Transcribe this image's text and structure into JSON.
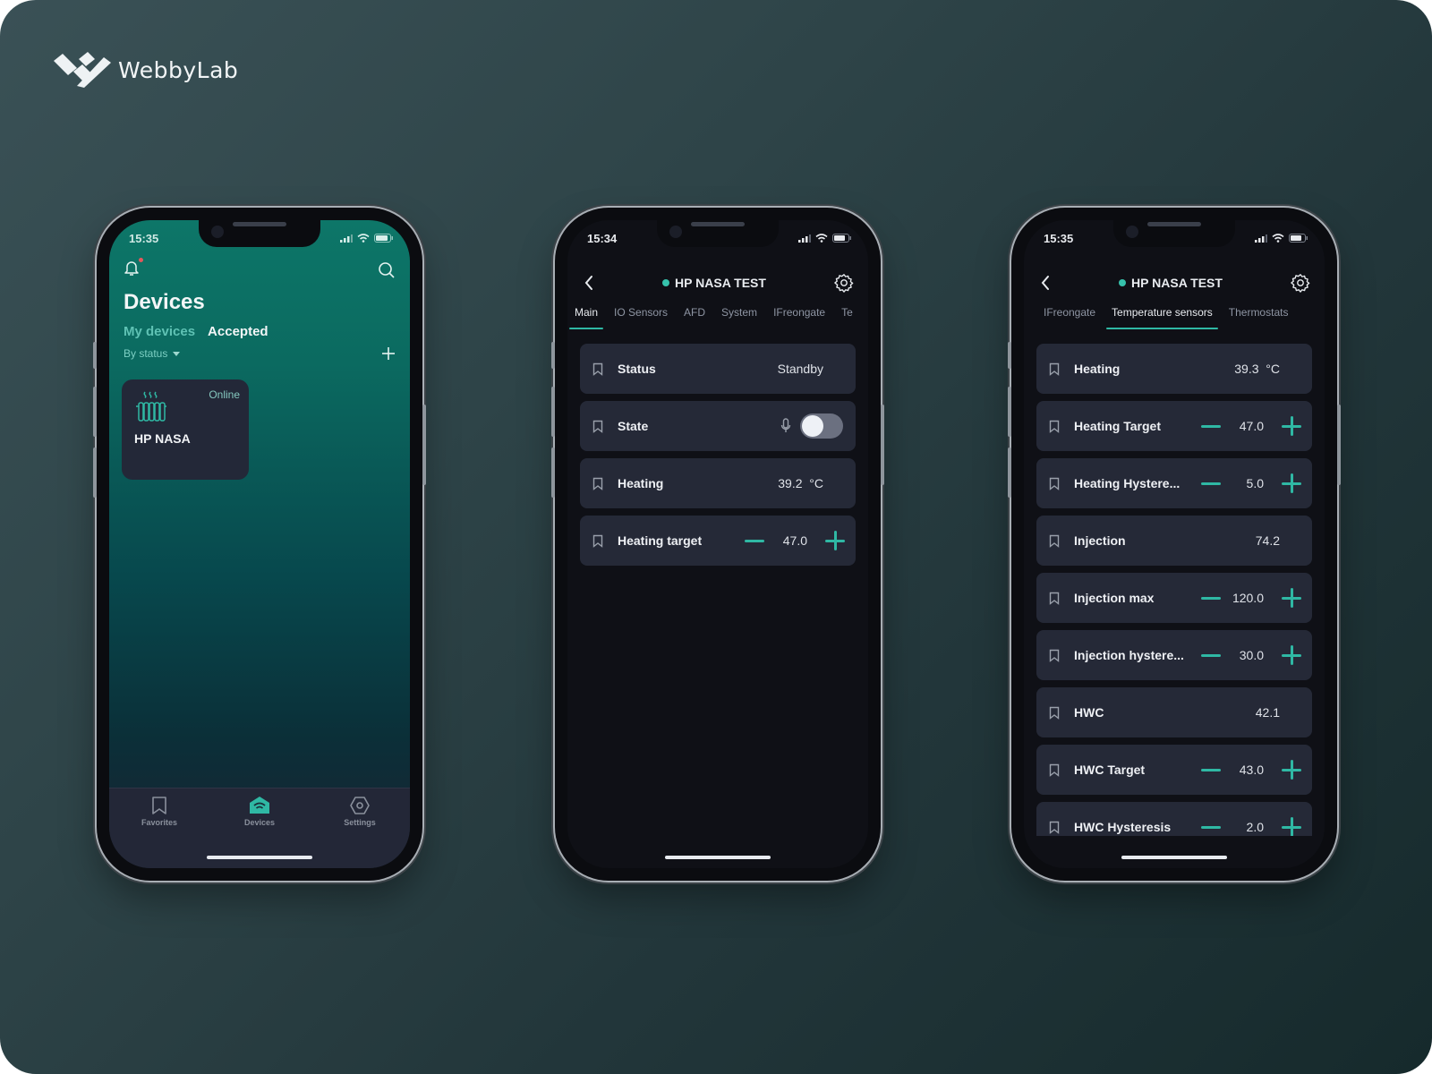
{
  "brand": {
    "name": "WebbyLab"
  },
  "colors": {
    "accent": "#2fb8a4",
    "online_dot": "#36c2ac",
    "notification_dot": "#e5575b",
    "card_bg": "#252937"
  },
  "phone1": {
    "time": "15:35",
    "title": "Devices",
    "tabs": [
      {
        "label": "My devices",
        "active": false
      },
      {
        "label": "Accepted",
        "active": true
      }
    ],
    "filter_label": "By status",
    "device_card": {
      "name": "HP NASA",
      "status": "Online",
      "icon": "radiator-icon"
    },
    "tabbar": [
      {
        "label": "Favorites",
        "icon": "bookmark-icon",
        "active": false
      },
      {
        "label": "Devices",
        "icon": "home-wifi-icon",
        "active": true
      },
      {
        "label": "Settings",
        "icon": "hex-gear-icon",
        "active": false
      }
    ]
  },
  "phone2": {
    "time": "15:34",
    "title": "HP NASA TEST",
    "tabs": [
      {
        "label": "Main",
        "active": true
      },
      {
        "label": "IO Sensors",
        "active": false
      },
      {
        "label": "AFD",
        "active": false
      },
      {
        "label": "System",
        "active": false
      },
      {
        "label": "IFreongate",
        "active": false
      },
      {
        "label": "Te",
        "active": false
      }
    ],
    "rows": [
      {
        "label": "Status",
        "value": "Standby",
        "type": "text"
      },
      {
        "label": "State",
        "type": "toggle",
        "toggle_on": false
      },
      {
        "label": "Heating",
        "value": "39.2  °C",
        "type": "text"
      },
      {
        "label": "Heating target",
        "value": "47.0",
        "type": "stepper"
      }
    ]
  },
  "phone3": {
    "time": "15:35",
    "title": "HP NASA TEST",
    "tabs": [
      {
        "label": "IFreongate",
        "active": false
      },
      {
        "label": "Temperature sensors",
        "active": true
      },
      {
        "label": "Thermostats",
        "active": false
      }
    ],
    "rows": [
      {
        "label": "Heating",
        "value": "39.3  °C",
        "type": "text"
      },
      {
        "label": "Heating Target",
        "value": "47.0",
        "type": "stepper"
      },
      {
        "label": "Heating Hystere...",
        "value": "5.0",
        "type": "stepper"
      },
      {
        "label": "Injection",
        "value": "74.2",
        "type": "text"
      },
      {
        "label": "Injection max",
        "value": "120.0",
        "type": "stepper"
      },
      {
        "label": "Injection hystere...",
        "value": "30.0",
        "type": "stepper"
      },
      {
        "label": "HWC",
        "value": "42.1",
        "type": "text"
      },
      {
        "label": "HWC Target",
        "value": "43.0",
        "type": "stepper"
      },
      {
        "label": "HWC Hysteresis",
        "value": "2.0",
        "type": "stepper"
      }
    ]
  }
}
